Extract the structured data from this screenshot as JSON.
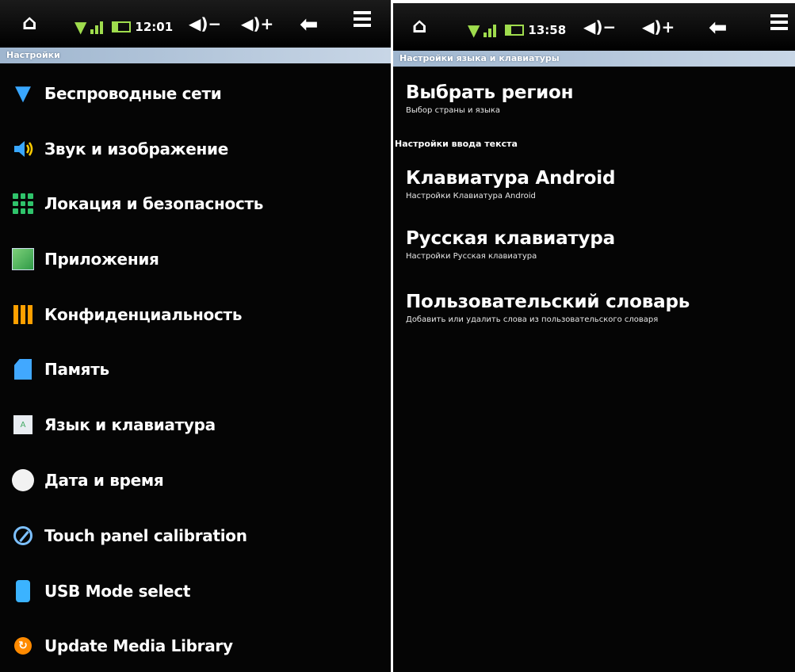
{
  "left": {
    "status": {
      "time": "12:01"
    },
    "header": "Настройки",
    "items": [
      {
        "label": "Беспроводные сети",
        "icon": "wifi-icon"
      },
      {
        "label": "Звук и изображение",
        "icon": "speaker-icon"
      },
      {
        "label": "Локация и безопасность",
        "icon": "location-security-icon"
      },
      {
        "label": "Приложения",
        "icon": "applications-icon"
      },
      {
        "label": "Конфиденциальность",
        "icon": "privacy-icon"
      },
      {
        "label": "Память",
        "icon": "memory-card-icon"
      },
      {
        "label": "Язык и клавиатура",
        "icon": "language-icon"
      },
      {
        "label": "Дата и время",
        "icon": "clock-icon"
      },
      {
        "label": "Touch panel calibration",
        "icon": "calibration-icon"
      },
      {
        "label": "USB Mode select",
        "icon": "usb-icon"
      },
      {
        "label": "Update Media Library",
        "icon": "update-icon"
      }
    ]
  },
  "right": {
    "status": {
      "time": "13:58"
    },
    "header": "Настройки языка и клавиатуры",
    "region": {
      "title": "Выбрать регион",
      "subtitle": "Выбор страны и языка"
    },
    "subsection": "Настройки ввода текста",
    "items": [
      {
        "title": "Клавиатура Android",
        "subtitle": "Настройки Клавиатура Android"
      },
      {
        "title": "Русская клавиатура",
        "subtitle": "Настройки Русская клавиатура"
      },
      {
        "title": "Пользовательский словарь",
        "subtitle": "Добавить или удалить слова из пользовательского словаря"
      }
    ]
  },
  "colors": {
    "accent_blue": "#39a7ff",
    "status_green": "#9fdc4d",
    "header_bar": "#b3c6db"
  }
}
